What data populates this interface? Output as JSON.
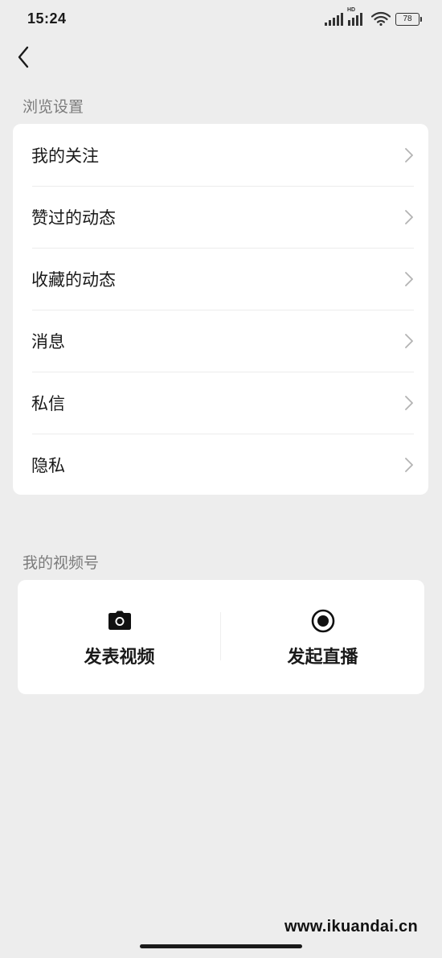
{
  "status_bar": {
    "time": "15:24",
    "battery": "78",
    "network_badge": "HD"
  },
  "browse_settings": {
    "title": "浏览设置",
    "items": [
      {
        "label": "我的关注"
      },
      {
        "label": "赞过的动态"
      },
      {
        "label": "收藏的动态"
      },
      {
        "label": "消息"
      },
      {
        "label": "私信"
      },
      {
        "label": "隐私"
      }
    ]
  },
  "my_channel": {
    "title": "我的视频号",
    "actions": [
      {
        "label": "发表视频",
        "icon": "camera-icon"
      },
      {
        "label": "发起直播",
        "icon": "live-record-icon"
      }
    ]
  },
  "watermark": "www.ikuandai.cn"
}
